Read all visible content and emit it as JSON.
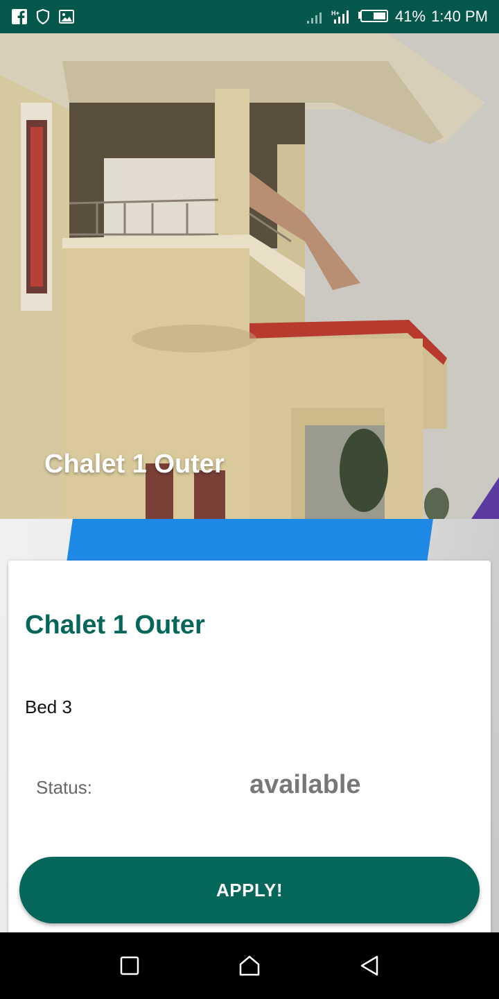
{
  "status_bar": {
    "battery": "41%",
    "time": "1:40 PM",
    "left_icons": [
      "facebook-icon",
      "shield-icon",
      "image-icon"
    ],
    "right_icons": [
      "signal-icon",
      "data-signal-icon",
      "battery-icon"
    ]
  },
  "hero": {
    "title": "Chalet 1 Outer"
  },
  "card": {
    "title": "Chalet 1 Outer",
    "bed": "Bed 3",
    "status_label": "Status:",
    "status_value": "available",
    "apply_label": "APPLY!"
  },
  "nav_bar": {
    "icons": [
      "recents-icon",
      "home-icon",
      "back-icon"
    ]
  },
  "colors": {
    "primary": "#04675a",
    "status_bar": "#04574b"
  }
}
